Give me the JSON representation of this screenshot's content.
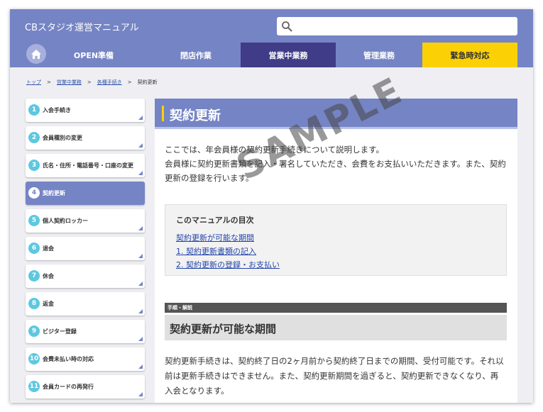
{
  "app": {
    "title": "CBスタジオ運営マニュアル"
  },
  "search": {
    "placeholder": "",
    "value": ""
  },
  "icons": {
    "search": "search-icon",
    "home": "home-icon"
  },
  "colors": {
    "header": "#7584c4",
    "active_tab": "#413c87",
    "emergency": "#fbd105",
    "number_badge": "#5dc8e0"
  },
  "nav": {
    "tabs": [
      {
        "label": "OPEN準備"
      },
      {
        "label": "閉店作業"
      },
      {
        "label": "営業中業務"
      },
      {
        "label": "管理業務"
      },
      {
        "label": "緊急時対応"
      }
    ]
  },
  "breadcrumb": {
    "items": [
      "トップ",
      "営業中業務",
      "各種手続き",
      "契約更新"
    ],
    "separator": ">"
  },
  "sidebar": {
    "items": [
      {
        "num": "1",
        "label": "入会手続き"
      },
      {
        "num": "2",
        "label": "会員種別の変更"
      },
      {
        "num": "3",
        "label": "氏名・住所・電話番号・口座の変更"
      },
      {
        "num": "4",
        "label": "契約更新"
      },
      {
        "num": "5",
        "label": "個人契約ロッカー"
      },
      {
        "num": "6",
        "label": "退会"
      },
      {
        "num": "7",
        "label": "休会"
      },
      {
        "num": "8",
        "label": "返金"
      },
      {
        "num": "9",
        "label": "ビジター登録"
      },
      {
        "num": "10",
        "label": "会費未払い時の対応"
      },
      {
        "num": "11",
        "label": "会員カードの再発行"
      }
    ]
  },
  "main": {
    "title": "契約更新",
    "intro": {
      "line1": "ここでは、年会員様の契約更新手続きについて説明します。",
      "line2": "会員様に契約更新書類を記入・署名していただき、会費をお支払いいただきます。また、契約",
      "line3": "更新の登録を行います。"
    },
    "toc": {
      "title": "このマニュアルの目次",
      "links": [
        "契約更新が可能な期間",
        "1. 契約更新書類の記入",
        "2. 契約更新の登録・お支払い"
      ]
    },
    "section": {
      "label": "手順・解説",
      "heading": "契約更新が可能な期間",
      "body": {
        "line1": "契約更新手続きは、契約終了日の2ヶ月前から契約終了日までの期間、受付可能です。それ以",
        "line2": "前は更新手続きはできません。また、契約更新期間を過ぎると、契約更新できなくなり、再",
        "line3": "入会となります。"
      }
    }
  },
  "watermark": "SAMPLE"
}
